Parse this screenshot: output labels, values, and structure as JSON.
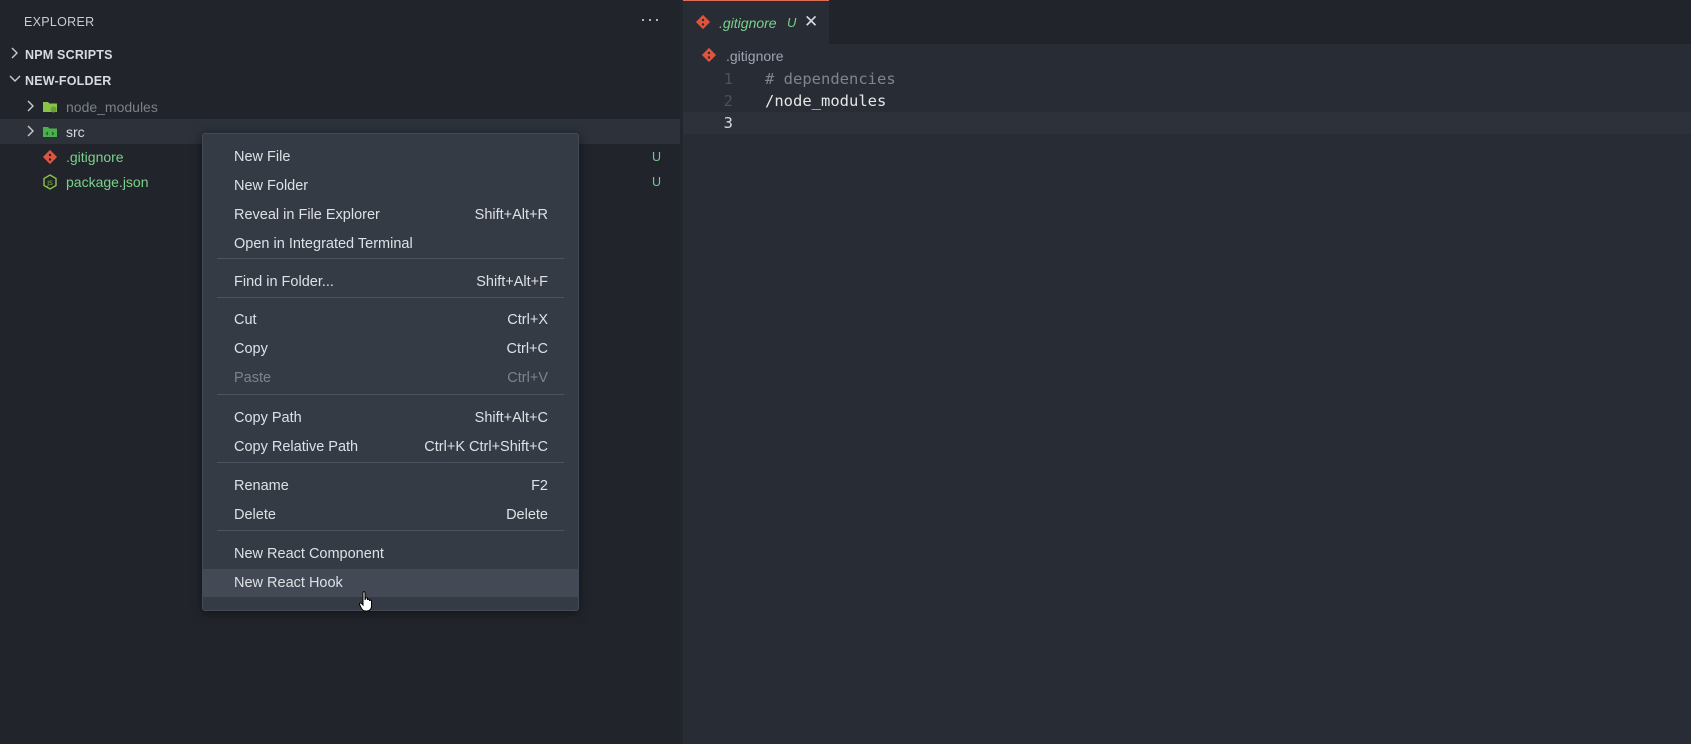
{
  "sidebar": {
    "title": "EXPLORER",
    "more_icon": "···",
    "sections": {
      "npm_scripts": "NPM SCRIPTS",
      "folder": "NEW-FOLDER"
    },
    "tree": [
      {
        "name": "node_modules",
        "icon": "folder-node-icon",
        "badge": ""
      },
      {
        "name": "src",
        "icon": "folder-src-icon",
        "badge": ""
      },
      {
        "name": ".gitignore",
        "icon": "git-icon",
        "badge": "U"
      },
      {
        "name": "package.json",
        "icon": "nodejs-icon",
        "badge": "U"
      }
    ]
  },
  "editor": {
    "tab": {
      "name": ".gitignore",
      "badge": "U",
      "close": "✕"
    },
    "breadcrumb": ".gitignore",
    "lines": [
      {
        "num": "1",
        "text": "# dependencies"
      },
      {
        "num": "2",
        "text": "/node_modules"
      },
      {
        "num": "3",
        "text": ""
      }
    ]
  },
  "context_menu": {
    "groups": [
      [
        {
          "label": "New File",
          "shortcut": ""
        },
        {
          "label": "New Folder",
          "shortcut": ""
        },
        {
          "label": "Reveal in File Explorer",
          "shortcut": "Shift+Alt+R"
        },
        {
          "label": "Open in Integrated Terminal",
          "shortcut": ""
        }
      ],
      [
        {
          "label": "Find in Folder...",
          "shortcut": "Shift+Alt+F"
        }
      ],
      [
        {
          "label": "Cut",
          "shortcut": "Ctrl+X"
        },
        {
          "label": "Copy",
          "shortcut": "Ctrl+C"
        },
        {
          "label": "Paste",
          "shortcut": "Ctrl+V",
          "disabled": true
        }
      ],
      [
        {
          "label": "Copy Path",
          "shortcut": "Shift+Alt+C"
        },
        {
          "label": "Copy Relative Path",
          "shortcut": "Ctrl+K Ctrl+Shift+C"
        }
      ],
      [
        {
          "label": "Rename",
          "shortcut": "F2"
        },
        {
          "label": "Delete",
          "shortcut": "Delete"
        }
      ],
      [
        {
          "label": "New React Component",
          "shortcut": ""
        },
        {
          "label": "New React Hook",
          "shortcut": "",
          "hovered": true
        }
      ]
    ]
  },
  "colors": {
    "untracked": "#73c991",
    "git_red": "#e0533d",
    "folder_green": "#8bc34a"
  }
}
